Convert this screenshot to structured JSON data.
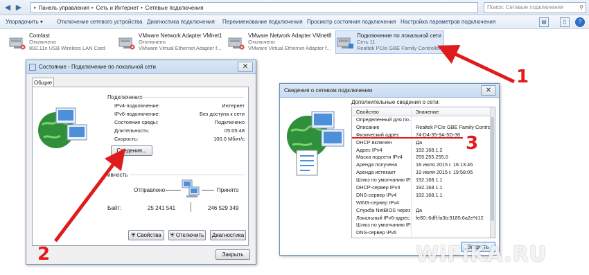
{
  "address_bar": {
    "breadcrumb": [
      "Панель управления",
      "Сеть и Интернет",
      "Сетевые подключения"
    ],
    "search_placeholder": "Поиск: Сетевые подключения"
  },
  "toolbar": {
    "items": [
      "Упорядочить ▾",
      "Отключение сетевого устройства",
      "Диагностика подключения",
      "Переименование подключения",
      "Просмотр состояния подключения",
      "Настройка параметров подключения"
    ]
  },
  "adapters": [
    {
      "name": "Comfast",
      "status": "Отключено",
      "device": "802.11n USB Wireless LAN Card"
    },
    {
      "name": "VMware Network Adapter VMnet1",
      "status": "Отключено",
      "device": "VMware Virtual Ethernet Adapter f..."
    },
    {
      "name": "VMware Network Adapter VMnet8",
      "status": "Отключено",
      "device": "VMware Virtual Ethernet Adapter f..."
    },
    {
      "name": "Подключение по локальной сети",
      "status": "Сеть  11",
      "device": "Realtek PCIe GBE Family Controller"
    }
  ],
  "status_dialog": {
    "title": "Состояние - Подключение по локальной сети",
    "tab": "Общие",
    "connection_group": "Подключение",
    "rows": [
      {
        "label": "IPv4-подключение:",
        "value": "Интернет"
      },
      {
        "label": "IPv6-подключение:",
        "value": "Без доступа к сети"
      },
      {
        "label": "Состояние среды:",
        "value": "Подключено"
      },
      {
        "label": "Длительность:",
        "value": "05:05:48"
      },
      {
        "label": "Скорость:",
        "value": "100.0 Мбит/с"
      }
    ],
    "details_button": "Сведения...",
    "activity_group": "ивность",
    "sent_label": "Отправлено",
    "received_label": "Принято",
    "bytes_label": "Байт:",
    "bytes_sent": "25 241 541",
    "bytes_received": "246 529 349",
    "properties_button": "Свойства",
    "disconnect_button": "Отключить",
    "diagnose_button": "Диагностика",
    "close_button": "Закрыть"
  },
  "details_dialog": {
    "title": "Сведения о сетевом подключении",
    "section": "Дополнительные сведения о сети:",
    "col_property": "Свойство",
    "col_value": "Значение",
    "rows": [
      {
        "p": "Определенный для по...",
        "v": ""
      },
      {
        "p": "Описание",
        "v": "Realtek PCIe GBE Family Controller"
      },
      {
        "p": "Физический адрес",
        "v": "74-D4-35-9A-5D-36"
      },
      {
        "p": "DHCP включен",
        "v": "Да"
      },
      {
        "p": "Адрес IPv4",
        "v": "192.168.1.2"
      },
      {
        "p": "Маска подсети IPv4",
        "v": "255.255.255.0"
      },
      {
        "p": "Аренда получена",
        "v": "18 июля 2015 г. 16:13:46"
      },
      {
        "p": "Аренда истекает",
        "v": "19 июля 2015 г. 19:58:05"
      },
      {
        "p": "Шлюз по умолчанию IP...",
        "v": "192.168.1.1"
      },
      {
        "p": "DHCP-сервер IPv4",
        "v": "192.168.1.1"
      },
      {
        "p": "DNS-сервер IPv4",
        "v": "192.168.1.1"
      },
      {
        "p": "WINS-сервер IPv4",
        "v": ""
      },
      {
        "p": "Служба NetBIOS через...",
        "v": "Да"
      },
      {
        "p": "Локальный IPv6-адрес...",
        "v": "fe80::6dff:fa3b:9185:6a2e%12"
      },
      {
        "p": "Шлюз по умолчанию IP...",
        "v": ""
      },
      {
        "p": "DNS-сервер IPv6",
        "v": ""
      }
    ],
    "close_button": "Закрыть"
  },
  "annotations": {
    "n1": "1",
    "n2": "2",
    "n3": "3",
    "color": "#e01b1b"
  },
  "watermark": "WiFiKA.RU"
}
